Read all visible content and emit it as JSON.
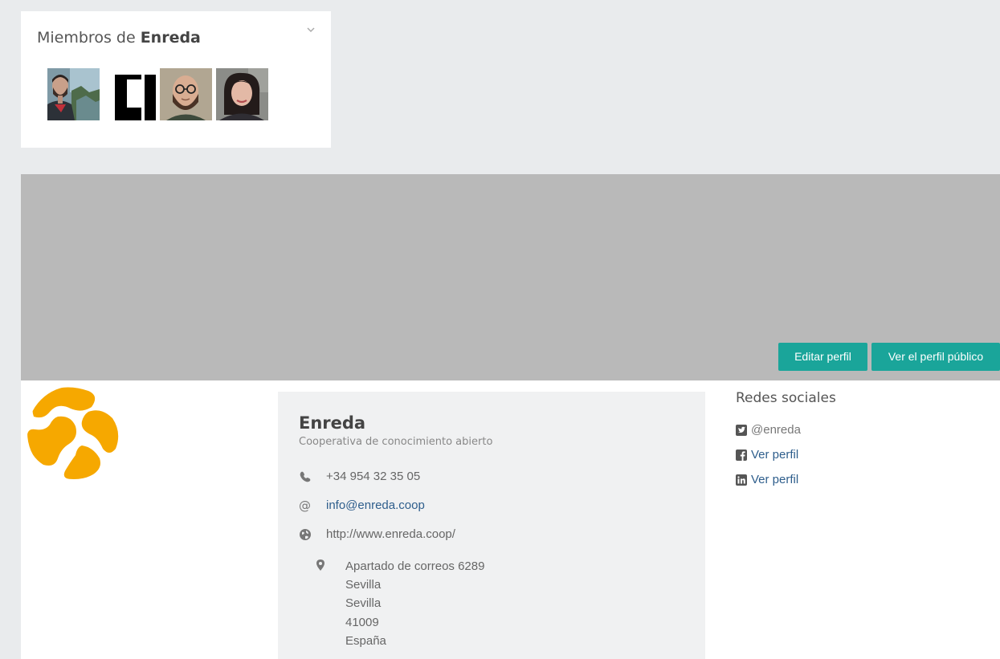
{
  "members": {
    "title_prefix": "Miembros de",
    "title_group": "Enreda",
    "avatars": [
      "avatar-bearded-man",
      "avatar-black-logo",
      "avatar-bald-glasses-man",
      "avatar-woman"
    ]
  },
  "profile_actions": {
    "edit_label": "Editar perfil",
    "public_label": "Ver el perfil público"
  },
  "organization": {
    "name": "Enreda",
    "description": "Cooperativa de conocimiento abierto",
    "phone": "+34 954 32 35 05",
    "email": "info@enreda.coop",
    "website": "http://www.enreda.coop/",
    "address": {
      "line1": "Apartado de correos 6289",
      "city": "Sevilla",
      "province": "Sevilla",
      "postal_code": "41009",
      "country": "España"
    }
  },
  "social": {
    "title": "Redes sociales",
    "twitter": "@enreda",
    "facebook": "Ver perfil",
    "linkedin": "Ver perfil"
  },
  "colors": {
    "accent": "#1aa59a",
    "logo": "#f6a800",
    "link": "#2e5e8c",
    "cover": "#b9b9b9"
  }
}
